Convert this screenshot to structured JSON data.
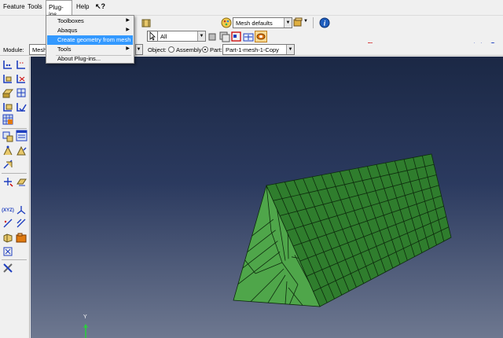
{
  "menubar": {
    "items": [
      {
        "label": "Feature",
        "mnemonic": ""
      },
      {
        "label": "Tools",
        "mnemonic": "T"
      },
      {
        "label": "Plug-ins",
        "mnemonic": ""
      },
      {
        "label": "Help",
        "mnemonic": "H"
      }
    ]
  },
  "plugins_menu": {
    "items": [
      {
        "label": "Toolboxes",
        "submenu": true,
        "highlighted": false
      },
      {
        "label": "Abaqus",
        "submenu": true,
        "highlighted": false
      },
      {
        "label": "Create geometry from mesh",
        "submenu": false,
        "highlighted": true
      },
      {
        "label": "Tools",
        "submenu": true,
        "highlighted": false
      },
      {
        "label": "About Plug-ins...",
        "submenu": false,
        "highlighted": false
      }
    ]
  },
  "toolbar": {
    "render_style": "Mesh defaults",
    "selection_filter": "All",
    "numbered_views": [
      "1",
      "2",
      "3",
      "4"
    ]
  },
  "context_bar": {
    "module_label": "Module:",
    "module_value": "Mesh",
    "object_label": "Object:",
    "assembly_label": "Assembly",
    "part_label": "Part:",
    "part_value": "Part-1-mesh-1-Copy",
    "object_selection": "Part"
  },
  "viewport": {
    "triad_label": "Y"
  },
  "colors": {
    "mesh_face_light": "#4fa64a",
    "mesh_face_dark": "#2f7d2d",
    "mesh_edge": "#0d2a0d",
    "menu_highlight": "#3399ff",
    "number_red": "#cc0000"
  }
}
